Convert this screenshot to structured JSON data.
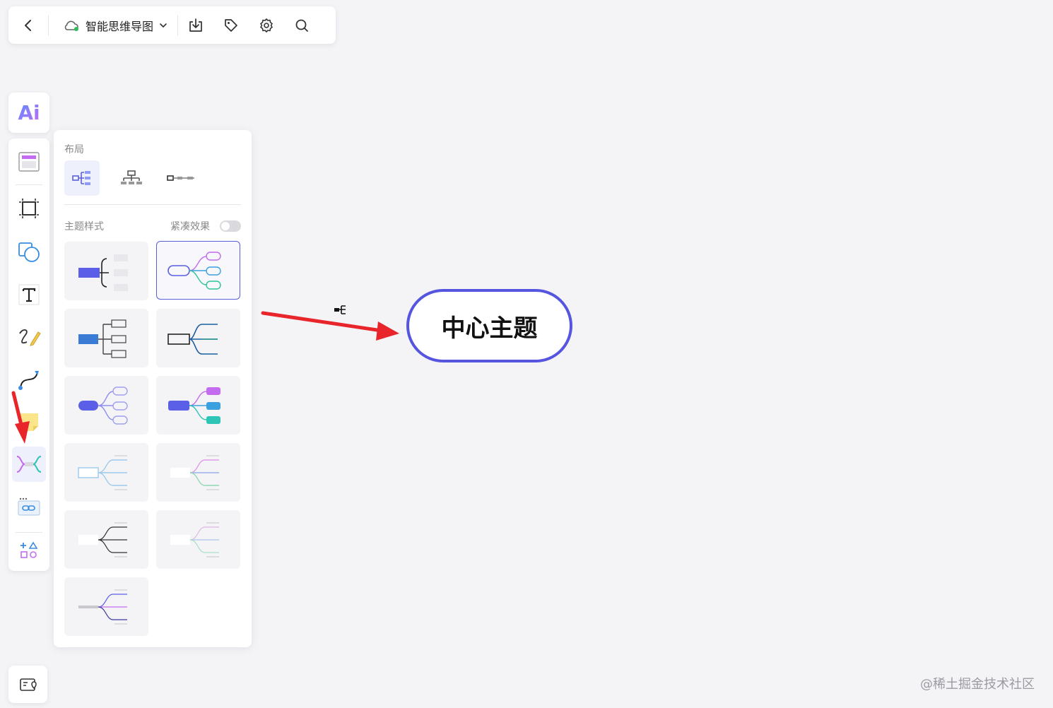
{
  "toolbar": {
    "doc_title": "智能思维导图",
    "buttons": [
      "back-icon",
      "download-icon",
      "tag-icon",
      "settings-icon",
      "search-icon"
    ]
  },
  "left_rail": {
    "ai_label": "Ai",
    "items": [
      "template-icon",
      "frame-icon",
      "shape-icon",
      "text-icon",
      "pen-icon",
      "connector-icon",
      "sticky-note-icon",
      "mindmap-icon",
      "embed-link-icon",
      "more-shapes-icon"
    ],
    "active_item": "mindmap-icon"
  },
  "panel": {
    "layout_label": "布局",
    "layouts": [
      "right-tree-layout",
      "org-chart-layout",
      "timeline-layout"
    ],
    "selected_layout": "right-tree-layout",
    "theme_label": "主题样式",
    "compact_label": "紧凑效果",
    "compact_enabled": false,
    "selected_style": 2
  },
  "canvas": {
    "center_topic": "中心主题",
    "node_border_color": "#5555e0"
  },
  "colors": {
    "accent": "#5b5fd8",
    "arrow": "#e8252b"
  },
  "watermark": "@稀土掘金技术社区"
}
